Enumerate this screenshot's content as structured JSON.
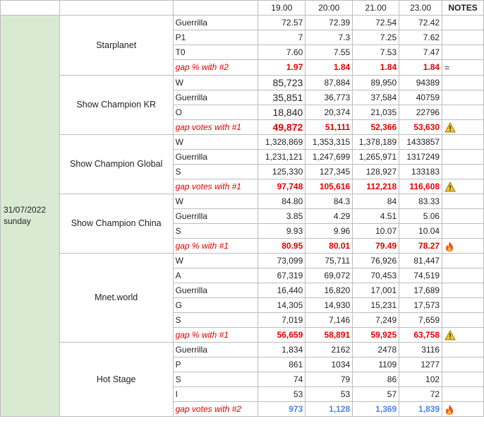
{
  "header": {
    "times": [
      "19.00",
      "20:00",
      "21.00",
      "23.00"
    ],
    "notes": "NOTES"
  },
  "date": {
    "line1": "31/07/2022",
    "line2": "sunday"
  },
  "groups": [
    {
      "name": "Starplanet",
      "rows": [
        {
          "label": "Guerrilla",
          "values": [
            "72.57",
            "72.39",
            "72.54",
            "72.42"
          ]
        },
        {
          "label": "P1",
          "values": [
            "7",
            "7.3",
            "7.25",
            "7.62"
          ]
        },
        {
          "label": "T0",
          "values": [
            "7.60",
            "7.55",
            "7.53",
            "7.47"
          ]
        }
      ],
      "gap": {
        "label": "gap % with #2",
        "values": [
          "1.97",
          "1.84",
          "1.84",
          "1.84"
        ],
        "note": "="
      }
    },
    {
      "name": "Show Champion KR",
      "rows": [
        {
          "label": "W",
          "values": [
            "85,723",
            "87,884",
            "89,950",
            "94389"
          ]
        },
        {
          "label": "Guerrilla",
          "values": [
            "35,851",
            "36,773",
            "37,584",
            "40759"
          ]
        },
        {
          "label": "O",
          "values": [
            "18,840",
            "20,374",
            "21,035",
            "22796"
          ]
        }
      ],
      "gap": {
        "label": "gap votes with #1",
        "values": [
          "49,872",
          "51,111",
          "52,366",
          "53,630"
        ],
        "note": "warning"
      }
    },
    {
      "name": "Show Champion Global",
      "rows": [
        {
          "label": "W",
          "values": [
            "1,328,869",
            "1,353,315",
            "1,378,189",
            "1433857"
          ]
        },
        {
          "label": "Guerrilla",
          "values": [
            "1,231,121",
            "1,247,699",
            "1,265,971",
            "1317249"
          ]
        },
        {
          "label": "S",
          "values": [
            "125,330",
            "127,345",
            "128,927",
            "133183"
          ]
        }
      ],
      "gap": {
        "label": "gap votes with #1",
        "values": [
          "97,748",
          "105,616",
          "112,218",
          "116,608"
        ],
        "note": "warning"
      }
    },
    {
      "name": "Show Champion China",
      "rows": [
        {
          "label": "W",
          "values": [
            "84.80",
            "84.3",
            "84",
            "83.33"
          ]
        },
        {
          "label": "Guerrilla",
          "values": [
            "3.85",
            "4.29",
            "4.51",
            "5.06"
          ]
        },
        {
          "label": "S",
          "values": [
            "9.93",
            "9.96",
            "10.07",
            "10.04"
          ]
        }
      ],
      "gap": {
        "label": "gap % with #1",
        "values": [
          "80.95",
          "80.01",
          "79.49",
          "78.27"
        ],
        "note": "fire"
      }
    },
    {
      "name": "Mnet.world",
      "rows": [
        {
          "label": "W",
          "values": [
            "73,099",
            "75,711",
            "76,926",
            "81,447"
          ]
        },
        {
          "label": "A",
          "values": [
            "67,319",
            "69,072",
            "70,453",
            "74,519"
          ]
        },
        {
          "label": "Guerrilla",
          "values": [
            "16,440",
            "16,820",
            "17,001",
            "17,689"
          ]
        },
        {
          "label": "G",
          "values": [
            "14,305",
            "14,930",
            "15,231",
            "17,573"
          ]
        },
        {
          "label": "S",
          "values": [
            "7,019",
            "7,146",
            "7,249",
            "7,659"
          ]
        }
      ],
      "gap": {
        "label": "gap % with #1",
        "values": [
          "56,659",
          "58,891",
          "59,925",
          "63,758"
        ],
        "note": "warning"
      }
    },
    {
      "name": "Hot Stage",
      "rows": [
        {
          "label": "Guerrilla",
          "values": [
            "1,834",
            "2162",
            "2478",
            "3116"
          ]
        },
        {
          "label": "P",
          "values": [
            "861",
            "1034",
            "1109",
            "1277"
          ]
        },
        {
          "label": "S",
          "values": [
            "74",
            "79",
            "86",
            "102"
          ]
        },
        {
          "label": "I",
          "values": [
            "53",
            "53",
            "57",
            "72"
          ]
        }
      ],
      "gap": {
        "label": "gap votes with #2",
        "values": [
          "973",
          "1,128",
          "1,369",
          "1,839"
        ],
        "note": "fire"
      }
    }
  ]
}
